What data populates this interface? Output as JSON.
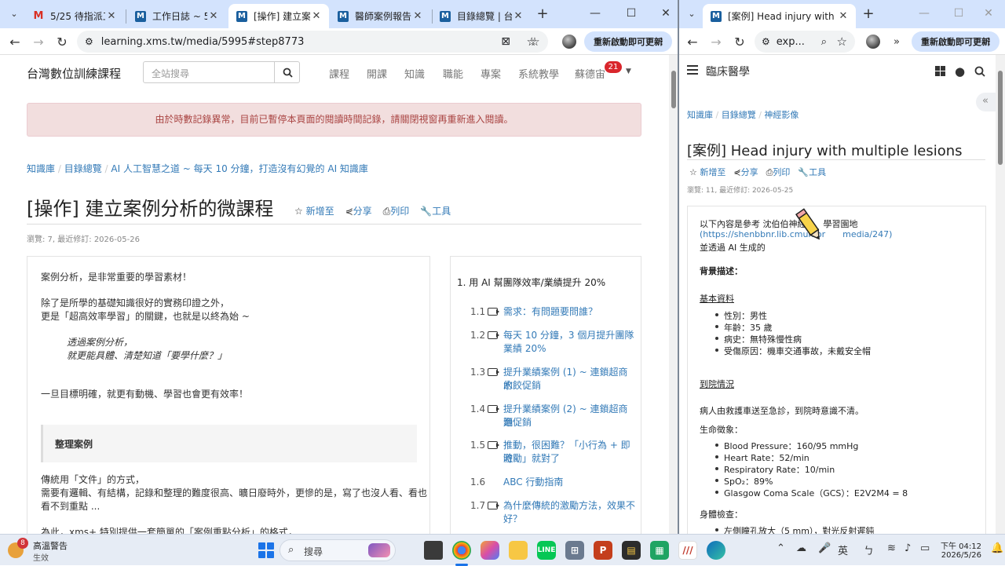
{
  "left_window": {
    "tabs": [
      {
        "label": "5/25 待指派工作",
        "icon": "gmail-icon"
      },
      {
        "label": "工作日誌 ~ 5/2",
        "icon": "m-logo-icon"
      },
      {
        "label": "[操作] 建立案例",
        "icon": "m-logo-icon"
      },
      {
        "label": "醫師案例報告",
        "icon": "m-logo-icon"
      },
      {
        "label": "目錄總覽 | 台灣",
        "icon": "m-logo-icon"
      }
    ],
    "url": "learning.xms.tw/media/5995#step8773",
    "update_button": "重新啟動即可更新",
    "site": {
      "brand": "台灣數位訓練課程",
      "search_placeholder": "全站搜尋",
      "menu": [
        "課程",
        "開課",
        "知識",
        "職能",
        "專案",
        "系統教學"
      ],
      "user_name": "蘇德宙",
      "notif_count": "21"
    },
    "alert": "由於時數記錄異常，目前已暫停本頁面的閱讀時間記錄，請關閉視窗再重新進入閱讀。",
    "breadcrumb": [
      "知識庫",
      "目錄總覽",
      "AI 人工智慧之道 ~ 每天 10 分鐘，打造沒有幻覺的 AI 知識庫"
    ],
    "title": "[操作] 建立案例分析的微課程",
    "actions": {
      "add": "新增至",
      "share": "分享",
      "print": "列印",
      "tools": "工具"
    },
    "meta": "瀏覽: 7, 最近修訂: 2026-05-26",
    "content": {
      "p1": "案例分析，是非常重要的學習素材！",
      "p2a": "除了是所學的基礎知識很好的實務印證之外，",
      "p2b": "更是「超高效率學習」的關鍵，也就是以終為始 ~",
      "quote1": "透過案例分析，",
      "quote2": "就更能具體、清楚知道「要學什麼？」",
      "p3": "一旦目標明確，就更有動機、學習也會更有效率！",
      "section": "整理案例",
      "p4a": "傳統用「文件」的方式，",
      "p4b": "需要有邏輯、有結構，記錄和整理的難度很高、曠日廢時外，更慘的是，寫了也沒人看、看也",
      "p4c": "看不到重點 ...",
      "p5": "為此，xms+ 特別提供一套簡單的「案例重點分析」的格式，"
    },
    "toc": {
      "heading": "1.  用 AI 幫團隊效率/業績提升 20%",
      "items": [
        {
          "num": "1.1",
          "text1": "需求：有問題要問誰？",
          "text2": "",
          "icon": "video-icon"
        },
        {
          "num": "1.2",
          "text1": "每天 10 分鐘，3 個月提升團隊",
          "text2": "業績 20%",
          "icon": "video-icon"
        },
        {
          "num": "1.3",
          "text1": "提升業績案例 (1) ~ 連鎖超商的",
          "text2": "水餃促銷",
          "icon": "video-icon"
        },
        {
          "num": "1.4",
          "text1": "提升業績案例 (2) ~ 連鎖超商泡",
          "text2": "麵促銷",
          "icon": "video-icon"
        },
        {
          "num": "1.5",
          "text1": "推動，很困難？「小行為 + 即時",
          "text2": "激勵」就對了",
          "icon": "video-icon"
        },
        {
          "num": "1.6",
          "text1": "ABC 行動指南",
          "text2": "",
          "icon": "abc-icon"
        },
        {
          "num": "1.7",
          "text1": "為什麼傳統的激勵方法，效果不",
          "text2": "好？",
          "icon": "video-icon"
        }
      ]
    }
  },
  "right_window": {
    "tab": "[案例] Head injury with multip",
    "url": "exp...",
    "update_button": "重新啟動即可更新",
    "site_title": "臨床醫學",
    "breadcrumb": [
      "知識庫",
      "目錄總覽",
      "神經影像"
    ],
    "title": "[案例] Head injury with multiple lesions",
    "actions": {
      "add": "新增至",
      "share": "分享",
      "print": "列印",
      "tools": "工具"
    },
    "meta": "瀏覽: 11, 最近修訂: 2026-05-25",
    "content": {
      "intro1": "以下內容是參考 沈伯伯神經",
      "intro1b": "學習園地",
      "intro2a": "(https://shenbbnr.lib.cmuh.or",
      "intro2b": "media/247)",
      "intro3": "並透過 AI 生成的",
      "bg_heading": "背景描述：",
      "basic_heading": "基本資料",
      "basic": [
        "性別：男性",
        "年齡：35 歲",
        "病史：無特殊慢性病",
        "受傷原因：機車交通事故，未戴安全帽"
      ],
      "arrival_heading": "到院情況",
      "arrival": "病人由救護車送至急診，到院時意識不清。",
      "vitals_heading": "生命徵象：",
      "vitals": [
        "Blood Pressure：160/95 mmHg",
        "Heart Rate：52/min",
        "Respiratory Rate：10/min",
        "SpO₂：89%",
        "Glasgow Coma Scale（GCS）：E2V2M4 = 8"
      ],
      "exam_heading": "身體檢查：",
      "exam": [
        "左側瞳孔放大（5 mm），對光反射遲鈍"
      ]
    }
  },
  "taskbar": {
    "weather_title": "高溫警告",
    "weather_sub": "生效",
    "weather_badge": "8",
    "search": "搜尋",
    "ime": "英",
    "time": "下午 04:12",
    "date": "2026/5/26"
  },
  "colors": {
    "accent": "#337ab7",
    "tab_strip": "#d3e3fd",
    "alert_bg": "#f2dede",
    "alert_text": "#a94442"
  }
}
